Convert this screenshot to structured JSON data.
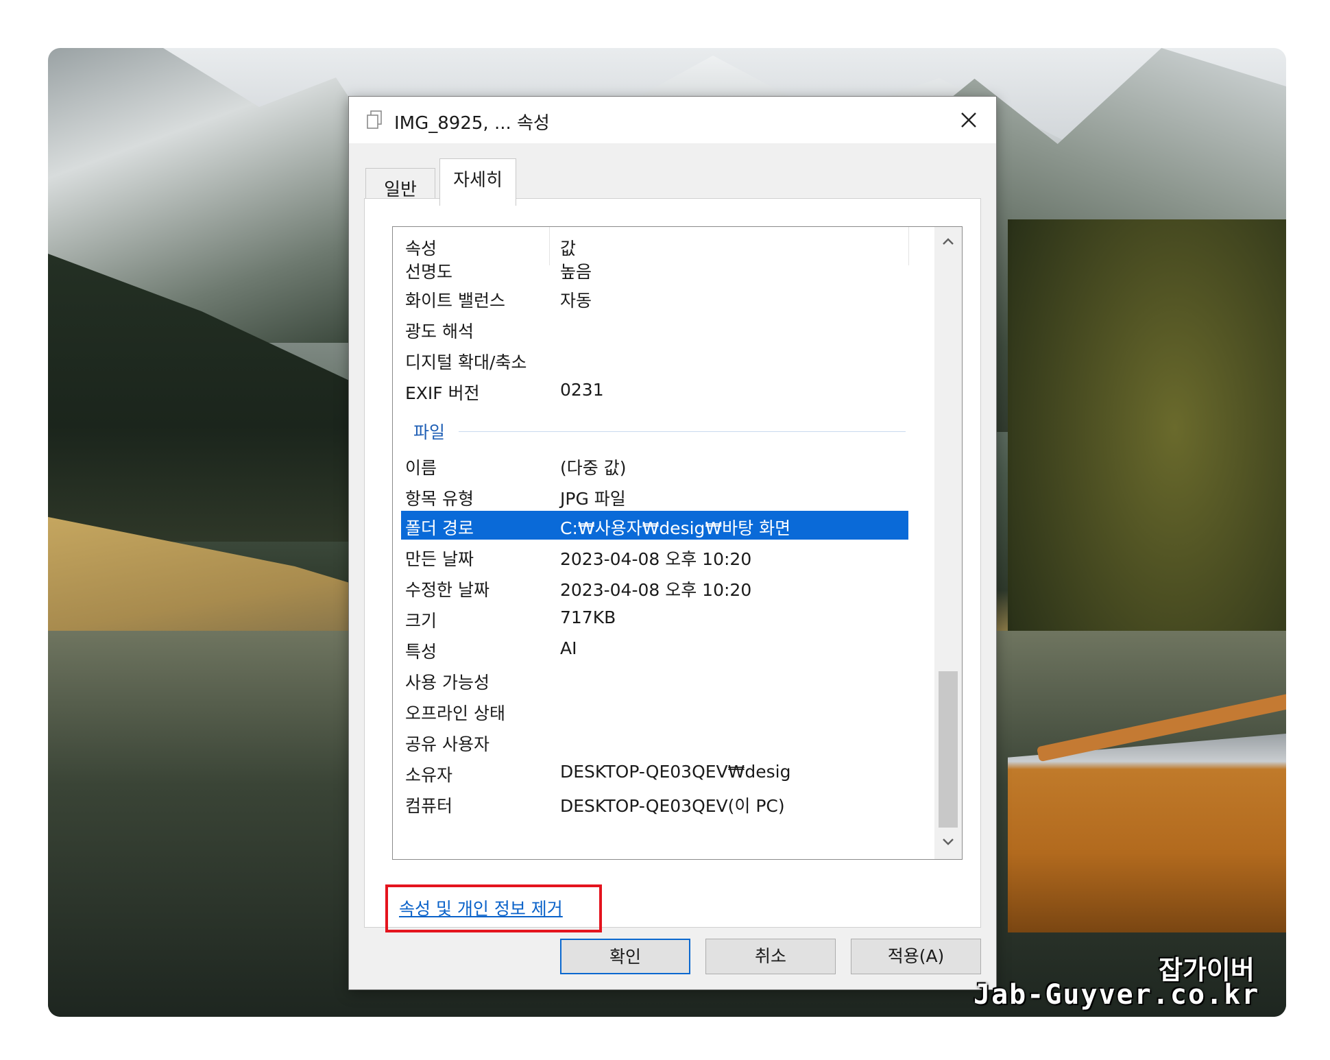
{
  "dialog": {
    "title": "IMG_8925, ... 속성",
    "tabs": [
      {
        "label": "일반"
      },
      {
        "label": "자세히"
      }
    ],
    "columns": {
      "property": "속성",
      "value": "값"
    },
    "rows_top": [
      {
        "key": "선명도",
        "value": "높음"
      },
      {
        "key": "화이트 밸런스",
        "value": "자동"
      },
      {
        "key": "광도 해석",
        "value": ""
      },
      {
        "key": "디지털 확대/축소",
        "value": ""
      },
      {
        "key": "EXIF 버전",
        "value": "0231"
      }
    ],
    "group_file": "파일",
    "rows_file": [
      {
        "key": "이름",
        "value": "(다중 값)"
      },
      {
        "key": "항목 유형",
        "value": "JPG 파일"
      },
      {
        "key": "폴더 경로",
        "value": "C:₩사용자₩desig₩바탕 화면"
      },
      {
        "key": "만든 날짜",
        "value": "2023-04-08 오후 10:20"
      },
      {
        "key": "수정한 날짜",
        "value": "2023-04-08 오후 10:20"
      },
      {
        "key": "크기",
        "value": "717KB"
      },
      {
        "key": "특성",
        "value": "AI"
      },
      {
        "key": "사용 가능성",
        "value": ""
      },
      {
        "key": "오프라인 상태",
        "value": ""
      },
      {
        "key": "공유 사용자",
        "value": ""
      },
      {
        "key": "소유자",
        "value": "DESKTOP-QE03QEV₩desig"
      },
      {
        "key": "컴퓨터",
        "value": "DESKTOP-QE03QEV(이 PC)"
      }
    ],
    "selected_row": "폴더 경로",
    "remove_link": "속성 및 개인 정보 제거",
    "buttons": {
      "ok": "확인",
      "cancel": "취소",
      "apply": "적용(A)"
    }
  },
  "watermark": {
    "line1": "잡가이버",
    "line2": "Jab-Guyver.co.kr"
  },
  "colors": {
    "selection": "#0a6ad8",
    "link": "#0a62c9",
    "highlight_box": "#e4141e",
    "group_header": "#1f5fb5"
  }
}
